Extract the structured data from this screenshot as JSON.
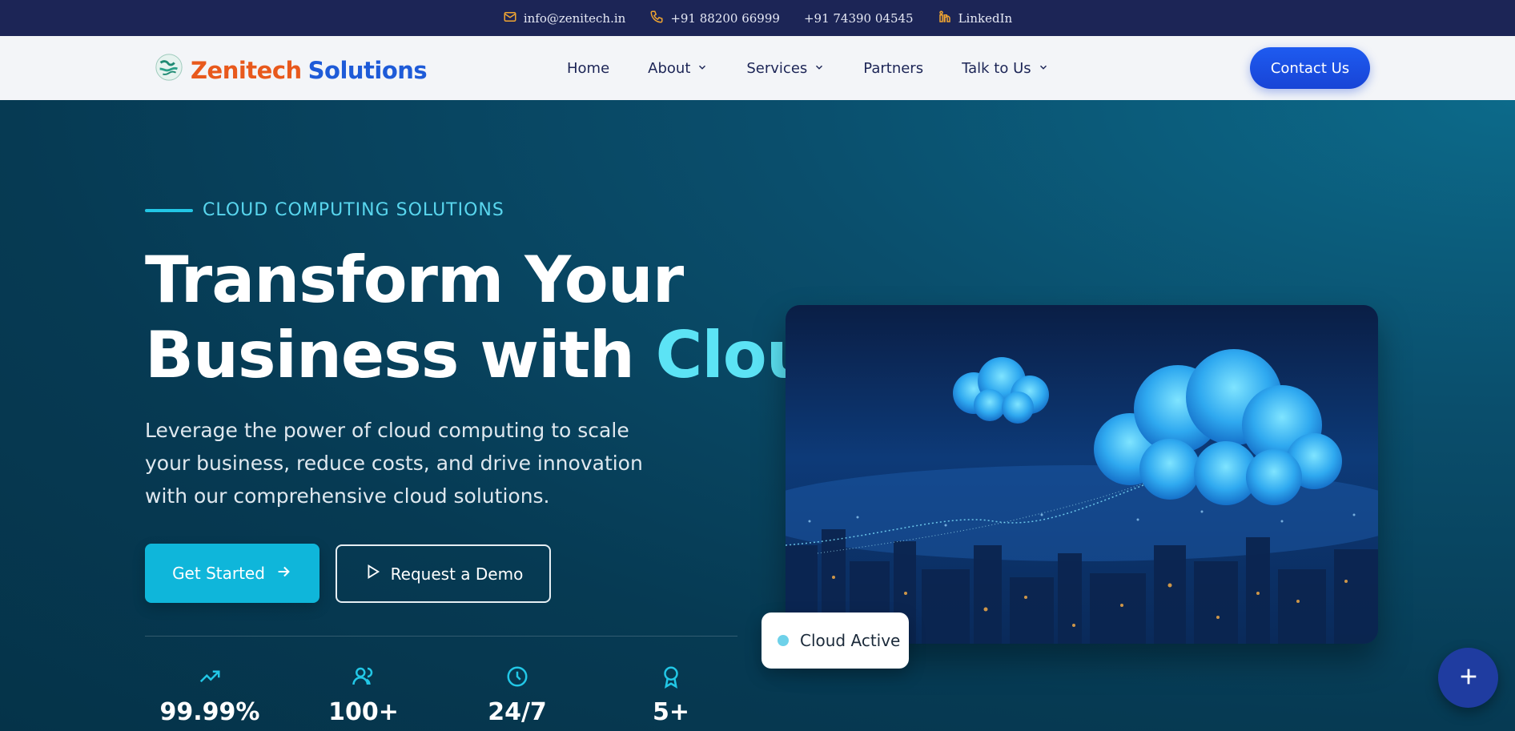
{
  "topbar": {
    "email": "info@zenitech.in",
    "phone1": "+91 88200 66999",
    "phone2": "+91 74390 04545",
    "linkedin": "LinkedIn",
    "icon_color": "#f0a531"
  },
  "header": {
    "logo_word1": "Zenitech",
    "logo_word2": "Solutions",
    "nav": [
      {
        "label": "Home"
      },
      {
        "label": "About"
      },
      {
        "label": "Services"
      },
      {
        "label": "Partners"
      },
      {
        "label": "Talk to Us"
      }
    ],
    "contact_label": "Contact Us"
  },
  "hero": {
    "eyebrow": "CLOUD COMPUTING SOLUTIONS",
    "headline_line1": "Transform Your",
    "headline_line2_a": "Business with ",
    "headline_line2_b": "Cloud",
    "subtext": "Leverage the power of cloud computing to scale your business, reduce costs, and drive innovation with our comprehensive cloud solutions.",
    "primary_button": "Get Started",
    "secondary_button": "Request a Demo",
    "badge_label": "Cloud Active",
    "accent_color": "#5ce3f5"
  },
  "stats": [
    {
      "icon": "trending-up-icon",
      "value": "99.99%"
    },
    {
      "icon": "users-icon",
      "value": "100+"
    },
    {
      "icon": "clock-icon",
      "value": "24/7"
    },
    {
      "icon": "award-icon",
      "value": "5+"
    }
  ]
}
